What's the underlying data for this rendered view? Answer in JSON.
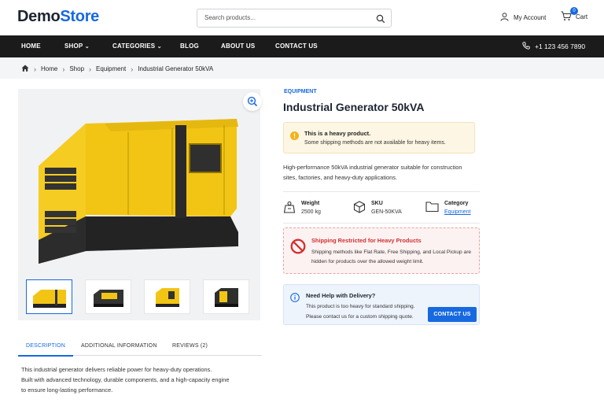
{
  "header": {
    "logo_part1": "Demo",
    "logo_part2": "Store",
    "search_placeholder": "Search products...",
    "account_label": "My Account",
    "cart_label": "Cart",
    "cart_count": "0"
  },
  "nav": {
    "items": [
      "HOME",
      "SHOP",
      "CATEGORIES",
      "BLOG",
      "ABOUT US",
      "CONTACT US"
    ],
    "phone": "+1 123 456 7890"
  },
  "breadcrumb": [
    "Home",
    "Shop",
    "Equipment",
    "Industrial Generator 50kVA"
  ],
  "product": {
    "category": "EQUIPMENT",
    "title": "Industrial Generator 50kVA",
    "warning_title": "This is a heavy product.",
    "warning_text": "Some shipping methods are not available for heavy items.",
    "description_line1": "High-performance 50kVA industrial generator suitable for construction",
    "description_line2": "sites, factories, and heavy-duty applications.",
    "specs": {
      "weight_label": "Weight",
      "weight_value": "2500 kg",
      "sku_label": "SKU",
      "sku_value": "GEN-50KVA",
      "category_label": "Category",
      "category_value": "Equipment"
    },
    "restriction_title": "Shipping Restricted for Heavy Products",
    "restriction_line1": "Shipping methods like Flat Rate, Free Shipping, and Local Pickup are",
    "restriction_line2": "hidden for products over the allowed weight limit.",
    "help_title": "Need Help with Delivery?",
    "help_line1": "This product is too heavy for standard shipping.",
    "help_line2": "Please contact us for a custom shipping quote.",
    "contact_button": "CONTACT US"
  },
  "tabs": [
    "DESCRIPTION",
    "ADDITIONAL INFORMATION",
    "REVIEWS (2)"
  ],
  "tab_description": {
    "line1": "This industrial generator delivers reliable power for heavy-duty operations.",
    "line2": "Built with advanced technology, durable components, and a high-capacity engine",
    "line3": "to ensure long-lasting performance."
  },
  "colors": {
    "accent": "#1769e0",
    "nav_bg": "#1b1b1b",
    "generator_yellow": "#f2c515",
    "warning_bg": "#fdf6e4",
    "error_red": "#d32f2f"
  }
}
